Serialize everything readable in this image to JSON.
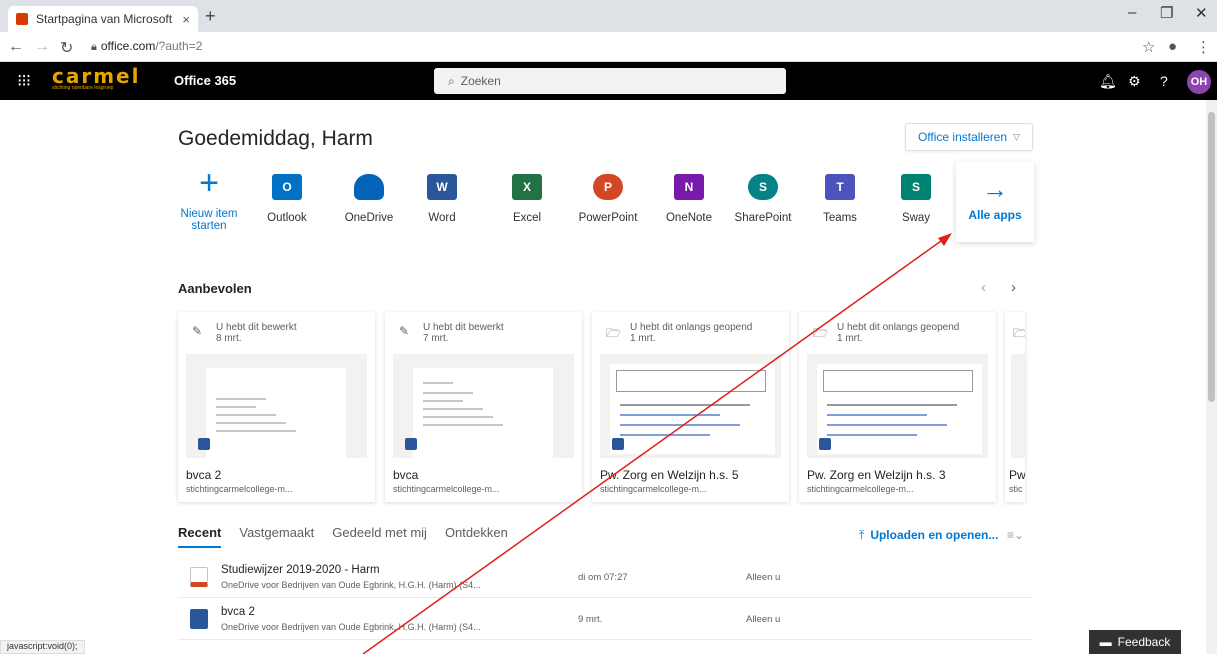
{
  "browser": {
    "tab_title": "Startpagina van Microsoft Office",
    "tab_close": "×",
    "new_tab": "+",
    "url_host": "office.com",
    "url_path": "/?auth=2",
    "minimize": "–",
    "restore": "❐",
    "close": "✕"
  },
  "header": {
    "logo_text": "carmel",
    "logo_sub": "stichting openbare lesgroep",
    "app_title": "Office 365",
    "search_placeholder": "Zoeken",
    "avatar_initials": "OH"
  },
  "main": {
    "greeting": "Goedemiddag, Harm",
    "install_label": "Office installeren",
    "apps": [
      {
        "label": "Nieuw item starten",
        "icon": "plus-icon",
        "color": "#0078d4"
      },
      {
        "label": "Outlook",
        "icon": "outlook-icon",
        "color": "#0072c6"
      },
      {
        "label": "OneDrive",
        "icon": "onedrive-icon",
        "color": "#0364b8"
      },
      {
        "label": "Word",
        "icon": "word-icon",
        "color": "#2b579a"
      },
      {
        "label": "Excel",
        "icon": "excel-icon",
        "color": "#217346"
      },
      {
        "label": "PowerPoint",
        "icon": "powerpoint-icon",
        "color": "#d24726"
      },
      {
        "label": "OneNote",
        "icon": "onenote-icon",
        "color": "#7719aa"
      },
      {
        "label": "SharePoint",
        "icon": "sharepoint-icon",
        "color": "#038387"
      },
      {
        "label": "Teams",
        "icon": "teams-icon",
        "color": "#4b53bc"
      },
      {
        "label": "Sway",
        "icon": "sway-icon",
        "color": "#008272"
      }
    ],
    "all_apps_label": "Alle apps",
    "recommended_title": "Aanbevolen",
    "cards": [
      {
        "activity": "U hebt dit bewerkt",
        "date": "8 mrt.",
        "name": "bvca 2",
        "site": "stichtingcarmelcollege-m..."
      },
      {
        "activity": "U hebt dit bewerkt",
        "date": "7 mrt.",
        "name": "bvca",
        "site": "stichtingcarmelcollege-m..."
      },
      {
        "activity": "U hebt dit onlangs geopend",
        "date": "1 mrt.",
        "name": "Pw. Zorg en Welzijn h.s. 5",
        "site": "stichtingcarmelcollege-m..."
      },
      {
        "activity": "U hebt dit onlangs geopend",
        "date": "1 mrt.",
        "name": "Pw. Zorg en Welzijn h.s. 3",
        "site": "stichtingcarmelcollege-m..."
      },
      {
        "activity": "",
        "date": "",
        "name": "Pw",
        "site": "stic"
      }
    ],
    "tabs": [
      "Recent",
      "Vastgemaakt",
      "Gedeeld met mij",
      "Ontdekken"
    ],
    "upload_label": "Uploaden en openen...",
    "files": [
      {
        "name": "Studiewijzer 2019-2020 - Harm",
        "path": "OneDrive voor Bedrijven van Oude Egbrink, H.G.H. (Harm) (S4...",
        "date": "di om 07:27",
        "share": "Alleen u"
      },
      {
        "name": "bvca 2",
        "path": "OneDrive voor Bedrijven van Oude Egbrink, H.G.H. (Harm) (S4...",
        "date": "9 mrt.",
        "share": "Alleen u"
      }
    ]
  },
  "status_text": "javascript:void(0);",
  "feedback_label": "Feedback"
}
